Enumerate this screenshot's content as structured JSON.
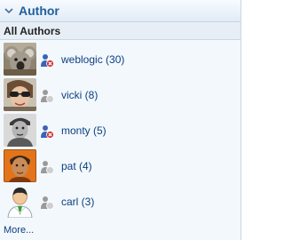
{
  "panel": {
    "title": "Author",
    "section_label": "All Authors",
    "more_label": "More..."
  },
  "authors": [
    {
      "label": "weblogic (30)",
      "status": "offline",
      "avatar": "koala-photo"
    },
    {
      "label": "vicki (8)",
      "status": "unknown",
      "avatar": "woman-sunglasses-photo"
    },
    {
      "label": "monty (5)",
      "status": "offline",
      "avatar": "black-white-portrait-photo"
    },
    {
      "label": "pat (4)",
      "status": "unknown",
      "avatar": "orange-portrait-photo"
    },
    {
      "label": "carl (3)",
      "status": "unknown",
      "avatar": "default-user-avatar"
    }
  ],
  "colors": {
    "title": "#215f9d",
    "link": "#0b3f80",
    "panel_bg": "#f3f8fd",
    "offline_badge": "#d42b2b",
    "presence_person": "#3b63b5"
  }
}
